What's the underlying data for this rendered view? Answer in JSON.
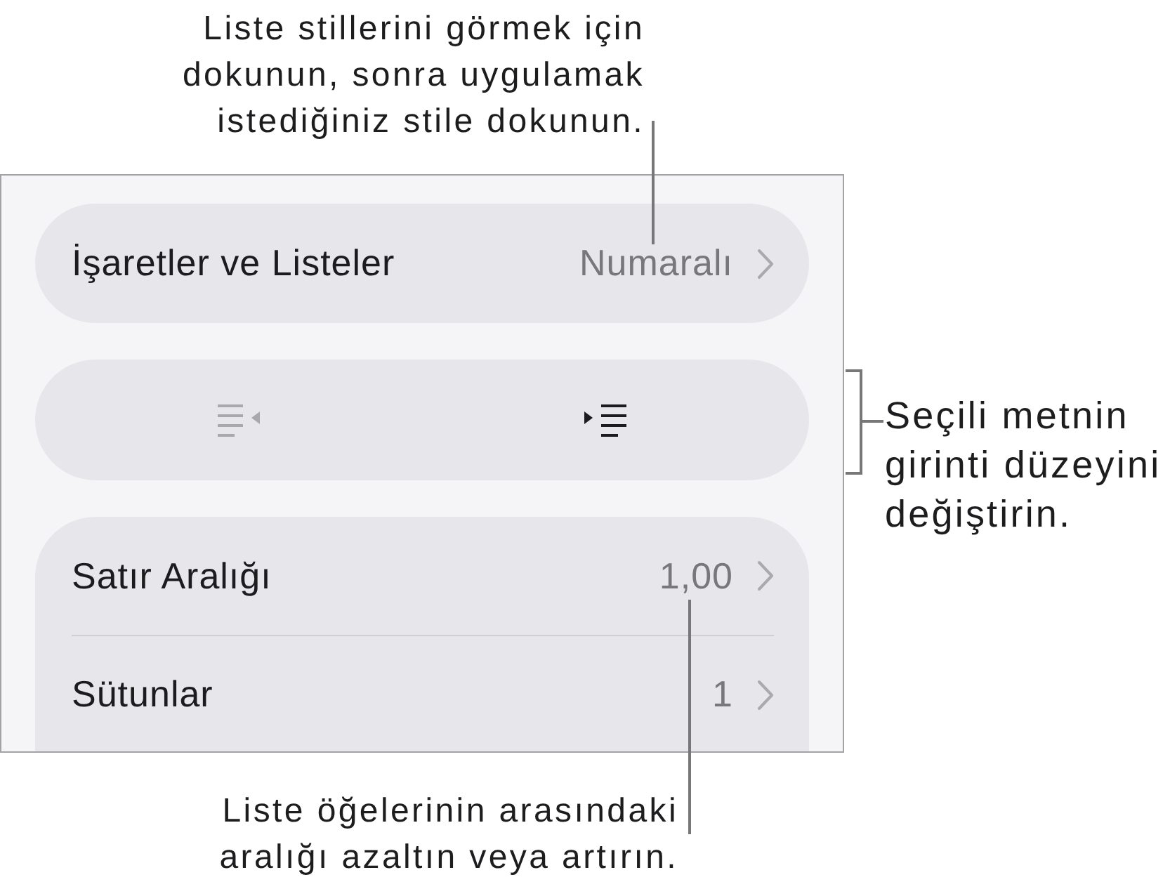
{
  "callouts": [
    {
      "kind": "top",
      "lines": [
        "Liste stillerini görmek için",
        "dokunun, sonra uygulamak",
        "istediğiniz stile dokunun."
      ]
    },
    {
      "kind": "right",
      "lines": [
        "Seçili metnin",
        "girinti düzeyini",
        "değiştirin."
      ]
    },
    {
      "kind": "bottom",
      "lines": [
        "Liste öğelerinin arasındaki",
        "aralığı azaltın veya artırın."
      ]
    }
  ],
  "panel": {
    "rows": [
      {
        "kind": "nav",
        "label": "İşaretler ve Listeler",
        "value": "Numaralı"
      },
      {
        "kind": "indent",
        "buttons": [
          {
            "kind": "outdent",
            "disabled": true
          },
          {
            "kind": "indent",
            "disabled": false
          }
        ]
      },
      {
        "kind": "group",
        "items": [
          {
            "label": "Satır Aralığı",
            "value": "1,00"
          },
          {
            "label": "Sütunlar",
            "value": "1"
          }
        ]
      }
    ]
  }
}
